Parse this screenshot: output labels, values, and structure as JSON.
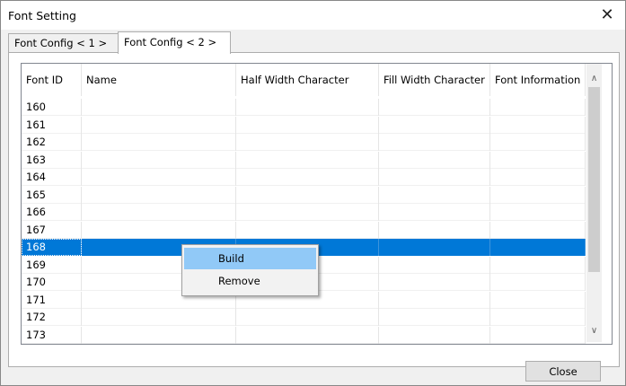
{
  "window": {
    "title": "Font Setting",
    "close_glyph": "✕"
  },
  "tabs": [
    {
      "label": "Font Config < 1 >",
      "active": false
    },
    {
      "label": "Font Config < 2 >",
      "active": true
    }
  ],
  "table": {
    "columns": [
      "Font ID",
      "Name",
      "Half Width Character",
      "Fill Width Character",
      "Font Information"
    ],
    "rows": [
      [
        "160",
        "",
        "",
        "",
        ""
      ],
      [
        "161",
        "",
        "",
        "",
        ""
      ],
      [
        "162",
        "",
        "",
        "",
        ""
      ],
      [
        "163",
        "",
        "",
        "",
        ""
      ],
      [
        "164",
        "",
        "",
        "",
        ""
      ],
      [
        "165",
        "",
        "",
        "",
        ""
      ],
      [
        "166",
        "",
        "",
        "",
        ""
      ],
      [
        "167",
        "",
        "",
        "",
        ""
      ],
      [
        "168",
        "",
        "",
        "",
        ""
      ],
      [
        "169",
        "",
        "",
        "",
        ""
      ],
      [
        "170",
        "",
        "",
        "",
        ""
      ],
      [
        "171",
        "",
        "",
        "",
        ""
      ],
      [
        "172",
        "",
        "",
        "",
        ""
      ],
      [
        "173",
        "",
        "",
        "",
        ""
      ]
    ],
    "selected_font_id": "168",
    "scroll": {
      "up_glyph": "∧",
      "down_glyph": "∨"
    }
  },
  "context_menu": {
    "items": [
      {
        "label": "Build",
        "highlighted": true
      },
      {
        "label": "Remove",
        "highlighted": false
      }
    ]
  },
  "buttons": {
    "close_label": "Close"
  },
  "colors": {
    "selection": "#0078d7",
    "menu_hover": "#91c9f7"
  }
}
